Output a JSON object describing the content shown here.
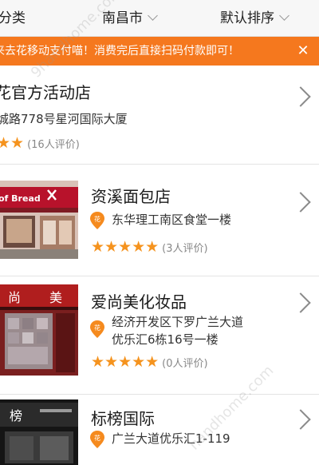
{
  "filters": {
    "category": "分类",
    "city": "南昌市",
    "sort": "默认排序"
  },
  "notice": {
    "text": "来去花移动支付喵！消费完后直接扫码付款即可！",
    "close_icon": "close-icon"
  },
  "stores": [
    {
      "name": "花官方活动店",
      "address": "城路778号星河国际大厦",
      "stars": "★★",
      "reviews": "(16人评价)"
    },
    {
      "name": "资溪面包店",
      "address": "东华理工南区食堂一楼",
      "stars": "★★★★★",
      "reviews": "(3人评价)",
      "thumb_sign": "of Bread"
    },
    {
      "name": "爱尚美化妆品",
      "address_line1": "经济开发区下罗广兰大道",
      "address_line2": "优乐汇6栋16号一楼",
      "stars": "★★★★★",
      "reviews": "(0人评价)",
      "thumb_sign_left": "尚",
      "thumb_sign_right": "美"
    },
    {
      "name": "标榜国际",
      "address": "广兰大道优乐汇1-119",
      "thumb_sign": "榜"
    }
  ],
  "colors": {
    "accent": "#f5781e",
    "star": "#f5931e",
    "pin": "#f58a1e"
  },
  "watermarks": [
    "9handhome.com",
    "handhome.com"
  ]
}
